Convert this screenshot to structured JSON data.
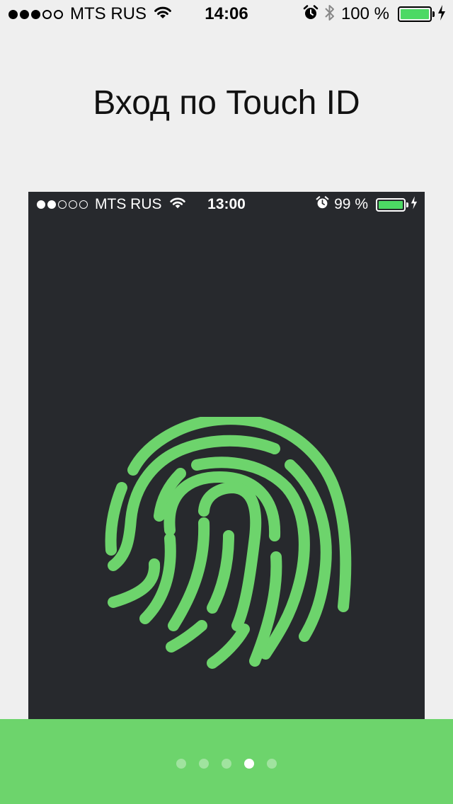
{
  "status_bar": {
    "carrier": "MTS RUS",
    "signal_bars": 3,
    "signal_total": 5,
    "time": "14:06",
    "battery_text": "100 %",
    "battery_level": 1.0,
    "icons": [
      "wifi-icon",
      "alarm-icon",
      "bluetooth-icon",
      "charging-icon"
    ]
  },
  "title": "Вход по Touch ID",
  "preview": {
    "status_bar": {
      "carrier": "MTS RUS",
      "signal_bars": 2,
      "signal_total": 5,
      "time": "13:00",
      "battery_text": "99 %",
      "battery_level": 0.99,
      "icons": [
        "wifi-icon",
        "alarm-icon",
        "charging-icon"
      ]
    },
    "background_color": "#27292d",
    "fingerprint_color": "#6dd46c",
    "icon": "fingerprint-icon"
  },
  "pager": {
    "total_pages": 5,
    "active_index": 3
  },
  "colors": {
    "accent": "#6dd46c",
    "battery_green": "#4cd964",
    "page_background": "#efefef"
  }
}
